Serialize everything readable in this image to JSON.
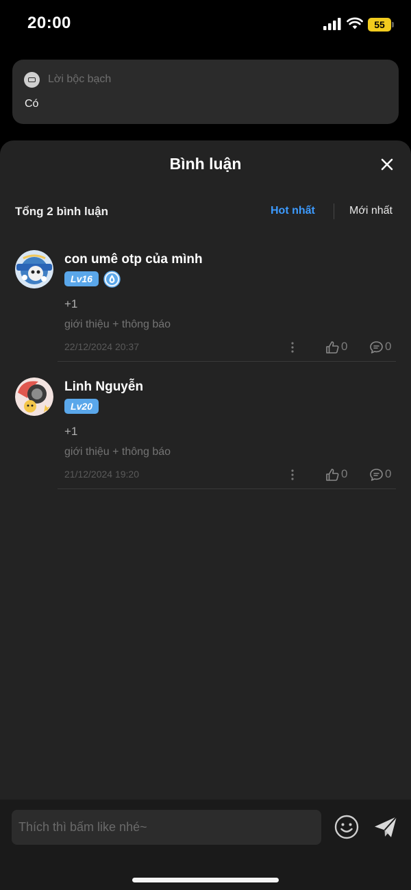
{
  "status_bar": {
    "time": "20:00",
    "battery": "55"
  },
  "confession": {
    "label": "Lời bộc bạch",
    "text": "Có"
  },
  "sheet": {
    "title": "Bình luận",
    "total_label": "Tổng 2 bình luận",
    "sort_hot": "Hot nhất",
    "sort_new": "Mới nhất",
    "active_sort_color": "#3d9bff"
  },
  "comments": [
    {
      "name": "con umê otp của mình",
      "level": "Lv16",
      "has_extra_badge": true,
      "body": "+1",
      "sub": "giới thiệu + thông báo",
      "date": "22/12/2024 20:37",
      "likes": "0",
      "replies": "0"
    },
    {
      "name": "Linh Nguyễn",
      "level": "Lv20",
      "has_extra_badge": false,
      "body": "+1",
      "sub": "giới thiệu + thông báo",
      "date": "21/12/2024 19:20",
      "likes": "0",
      "replies": "0"
    }
  ],
  "composer": {
    "placeholder": "Thích thì bấm like nhé~"
  },
  "colors": {
    "badge": "#5aa7ea",
    "sheet_bg": "#232323",
    "battery": "#f2cc1e"
  },
  "icons": [
    "signal-icon",
    "wifi-icon",
    "close-icon",
    "more-icon",
    "like-icon",
    "reply-icon",
    "emoji-icon",
    "send-icon"
  ]
}
